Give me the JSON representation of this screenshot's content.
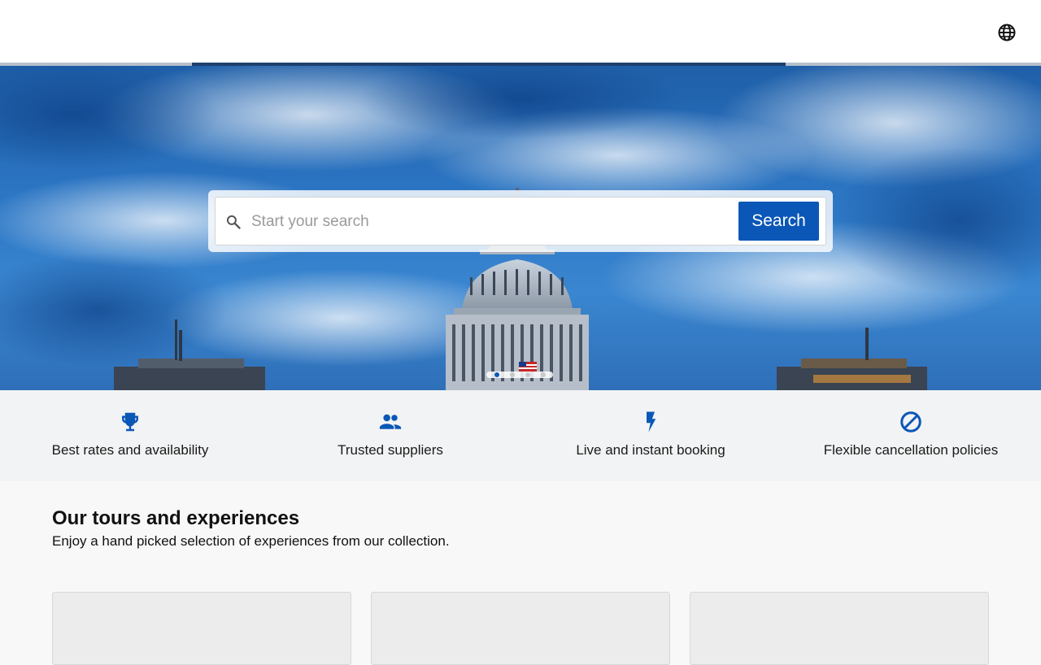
{
  "header": {
    "language_icon": "globe-icon"
  },
  "hero": {
    "slide_count": 4,
    "active_slide": 1,
    "load_progress": 0.57
  },
  "search": {
    "placeholder": "Start your search",
    "value": "",
    "button_label": "Search",
    "icon": "search-icon"
  },
  "features": [
    {
      "icon": "trophy-icon",
      "label": "Best rates and availability"
    },
    {
      "icon": "group-icon",
      "label": "Trusted suppliers"
    },
    {
      "icon": "lightning-bolt-icon",
      "label": "Live and instant booking"
    },
    {
      "icon": "no-entry-icon",
      "label": "Flexible cancellation policies"
    }
  ],
  "collection": {
    "title": "Our tours and experiences",
    "subtitle": "Enjoy a hand picked selection of experiences from our collection."
  },
  "colors": {
    "accent": "#0b57b7",
    "feature_icon": "#0b57b7",
    "features_bg": "#f2f3f4"
  }
}
